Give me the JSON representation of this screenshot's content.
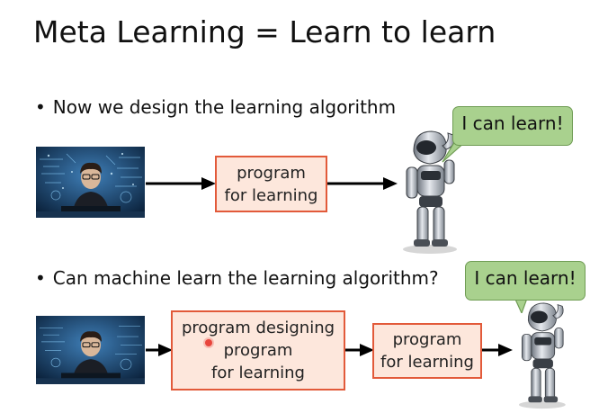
{
  "slide": {
    "title": "Meta Learning = Learn to learn"
  },
  "section1": {
    "bullet_marker": "•",
    "bullet": "Now we design the learning algorithm",
    "box": {
      "line1": "program",
      "line2": "for learning"
    },
    "speech": "I can learn!"
  },
  "section2": {
    "bullet_marker": "•",
    "bullet": "Can machine learn the learning algorithm?",
    "box_designer": {
      "line1": "program designing",
      "line2": "program",
      "line3": "for learning"
    },
    "box_program": {
      "line1": "program",
      "line2": "for learning"
    },
    "speech": "I can learn!"
  },
  "colors": {
    "box_border": "#e25a3a",
    "box_fill": "#fde7dc",
    "bubble_fill": "#a9d18e",
    "arrow": "#000000"
  },
  "icons": {
    "person_photo": "programmer-at-screens-image",
    "robot": "robot-thinking-image",
    "arrow": "right-arrow-icon",
    "cursor": "laser-pointer-dot"
  }
}
